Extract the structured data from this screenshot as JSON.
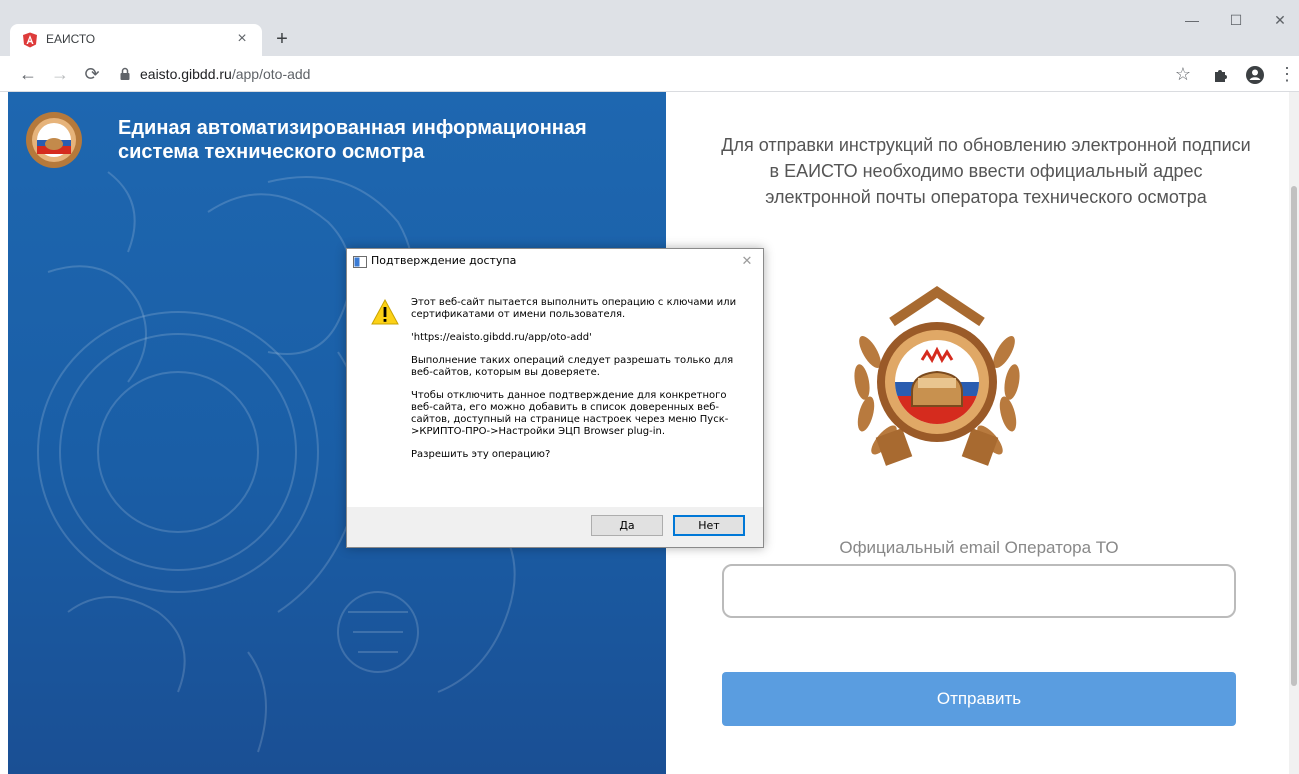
{
  "browser": {
    "tab_title": "ЕАИСТО",
    "tab_close": "×",
    "new_tab": "+",
    "url_host": "eaisto.gibdd.ru",
    "url_path": "/app/oto-add",
    "window_minimize": "—",
    "window_maximize": "☐",
    "window_close": "✕"
  },
  "site": {
    "title": "Единая автоматизированная информационная система технического осмотра"
  },
  "form": {
    "instructions": "Для отправки инструкций по обновлению электронной подписи в ЕАИСТО необходимо ввести официальный адрес электронной почты оператора технического осмотра",
    "email_label": "Официальный email Оператора ТО",
    "email_value": "",
    "submit_label": "Отправить"
  },
  "dialog": {
    "title": "Подтверждение доступа",
    "close": "✕",
    "line1": "Этот веб-сайт пытается выполнить операцию с ключами или сертификатами от имени пользователя.",
    "url": "'https://eaisto.gibdd.ru/app/oto-add'",
    "line2": "Выполнение таких операций следует разрешать только для веб-сайтов, которым вы доверяете.",
    "line3": "Чтобы отключить данное подтверждение для конкретного веб-сайта, его можно добавить в список доверенных веб-сайтов, доступный на странице настроек через меню Пуск->КРИПТО-ПРО->Настройки ЭЦП Browser plug-in.",
    "question": "Разрешить эту операцию?",
    "yes_label": "Да",
    "no_label": "Нет"
  },
  "icons": {
    "favicon": "angular-shield-icon",
    "lock": "lock-icon",
    "star": "star-icon",
    "extensions": "puzzle-icon",
    "profile": "profile-icon",
    "menu": "kebab-menu-icon",
    "warning": "warning-triangle-icon",
    "emblem": "gibdd-emblem"
  },
  "colors": {
    "left_panel": "#1e67b0",
    "submit_button": "#5a9de0",
    "dialog_default_border": "#0078d7"
  }
}
